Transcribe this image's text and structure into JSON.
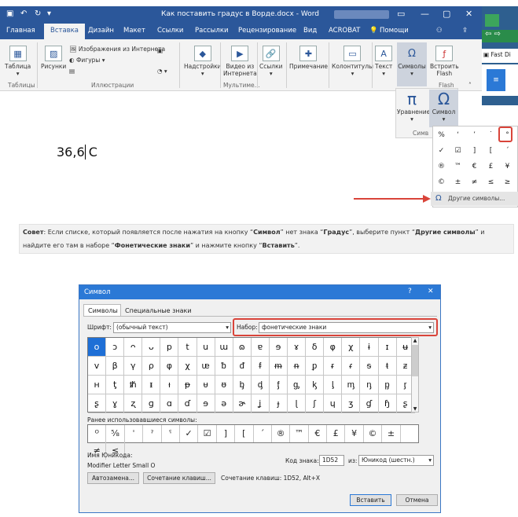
{
  "window": {
    "title": "Как поставить градус в Ворде.docx - Word"
  },
  "tabs": [
    "Главная",
    "Вставка",
    "Дизайн",
    "Макет",
    "Ссылки",
    "Рассылки",
    "Рецензирование",
    "Вид",
    "ACROBAT",
    "Помощи"
  ],
  "ribbon": {
    "table": "Таблица",
    "pictures": "Рисунки",
    "online_pictures": "Изображения из Интернета",
    "shapes": "Фигуры",
    "addins": "Надстройки",
    "video1": "Видео из",
    "video2": "Интернета",
    "links": "Ссылки",
    "comment": "Примечание",
    "headers": "Колонтитулы",
    "text": "Текст",
    "symbols": "Символы",
    "flash1": "Встроить",
    "flash2": "Flash",
    "groups": {
      "tables": "Таблицы",
      "illustrations": "Иллюстрации",
      "multimedia": "Мультиме...",
      "flash": "Flash",
      "symbols": "Симв"
    },
    "equation": "Уравнение",
    "symbol": "Символ"
  },
  "side": {
    "text": "Fast Di"
  },
  "doc": {
    "text": "36,6 С"
  },
  "menu": {
    "cells": [
      "%",
      "‘",
      "’",
      "˙",
      "°",
      "✓",
      "☑",
      "]",
      "[",
      "´",
      "®",
      "™",
      "€",
      "£",
      "¥",
      "©",
      "±",
      "≠",
      "≤",
      "≥"
    ],
    "other": "Другие символы..."
  },
  "tip": {
    "p1": "Совет",
    "p2": ": Если списке, который появляется после нажатия на кнопку “",
    "p3": "Символ",
    "p4": "” нет знака “",
    "p5": "Градус",
    "p6": "”, выберите пункт “",
    "p7": "Другие символы",
    "p8": "” и найдите его там в наборе “",
    "p9": "Фонетические знаки",
    "p10": "” и нажмите кнопку “",
    "p11": "Вставить",
    "p12": "”."
  },
  "dialog": {
    "title": "Символ",
    "help": "?",
    "close": "✕",
    "tab_symbols": "Символы",
    "tab_special": "Специальные знаки",
    "font_label": "Шрифт:",
    "font_value": "(обычный текст)",
    "set_label": "Набор:",
    "set_value": "фонетические знаки",
    "grid": [
      [
        "ο",
        "ɔ",
        "ᴖ",
        "ᴗ",
        "p",
        "t",
        "u",
        "ɯ",
        "ɷ",
        "ɐ",
        "ɘ",
        "ɤ",
        "δ",
        "φ",
        "χ",
        "ɨ",
        "ɪ",
        "ʉ"
      ],
      [
        "v",
        "β",
        "γ",
        "ρ",
        "φ",
        "χ",
        "ᵫ",
        "ᵬ",
        "ᵭ",
        "ᵮ",
        "ᵯ",
        "ᵰ",
        "ᵱ",
        "ᵲ",
        "ᵳ",
        "ᵴ",
        "ᵵ",
        "ᵶ"
      ],
      [
        "ʜ",
        "ƫ",
        "ᵺ",
        "ᵻ",
        "ᵼ",
        "ᵽ",
        "ᵾ",
        "ᵿ",
        "ᶀ",
        "ᶁ",
        "ᶂ",
        "ᶃ",
        "ᶄ",
        "ᶅ",
        "ᶆ",
        "ᶇ",
        "ᶈ",
        "ᶉ"
      ],
      [
        "ʂ",
        "ɣ",
        "ʐ",
        "ɡ",
        "ɑ",
        "ɗ",
        "ɘ",
        "ə",
        "ɚ",
        "ʝ",
        "ɟ",
        "ɭ",
        "ʃ",
        "ɥ",
        "ʒ",
        "ɠ",
        "ɧ",
        "ʂ"
      ]
    ],
    "recent_label": "Ранее использовавшиеся символы:",
    "recent": [
      "ᴼ",
      "⅝",
      "ˈ",
      "ˀ",
      "ˁ",
      "✓",
      "☑",
      "]",
      "[",
      "´",
      "®",
      "™",
      "€",
      "£",
      "¥",
      "©",
      "±",
      "≠",
      "≤"
    ],
    "unicode_label": "Имя Юникода:",
    "unicode_name": "Modifier Letter Small O",
    "code_label": "Код знака:",
    "code_value": "1D52",
    "from_label": "из:",
    "from_value": "Юникод (шестн.)",
    "autocorrect": "Автозамена...",
    "shortcut": "Сочетание клавиш...",
    "shortcut_text": "Сочетание клавиш: 1D52, Alt+X",
    "insert": "Вставить",
    "cancel": "Отмена"
  }
}
